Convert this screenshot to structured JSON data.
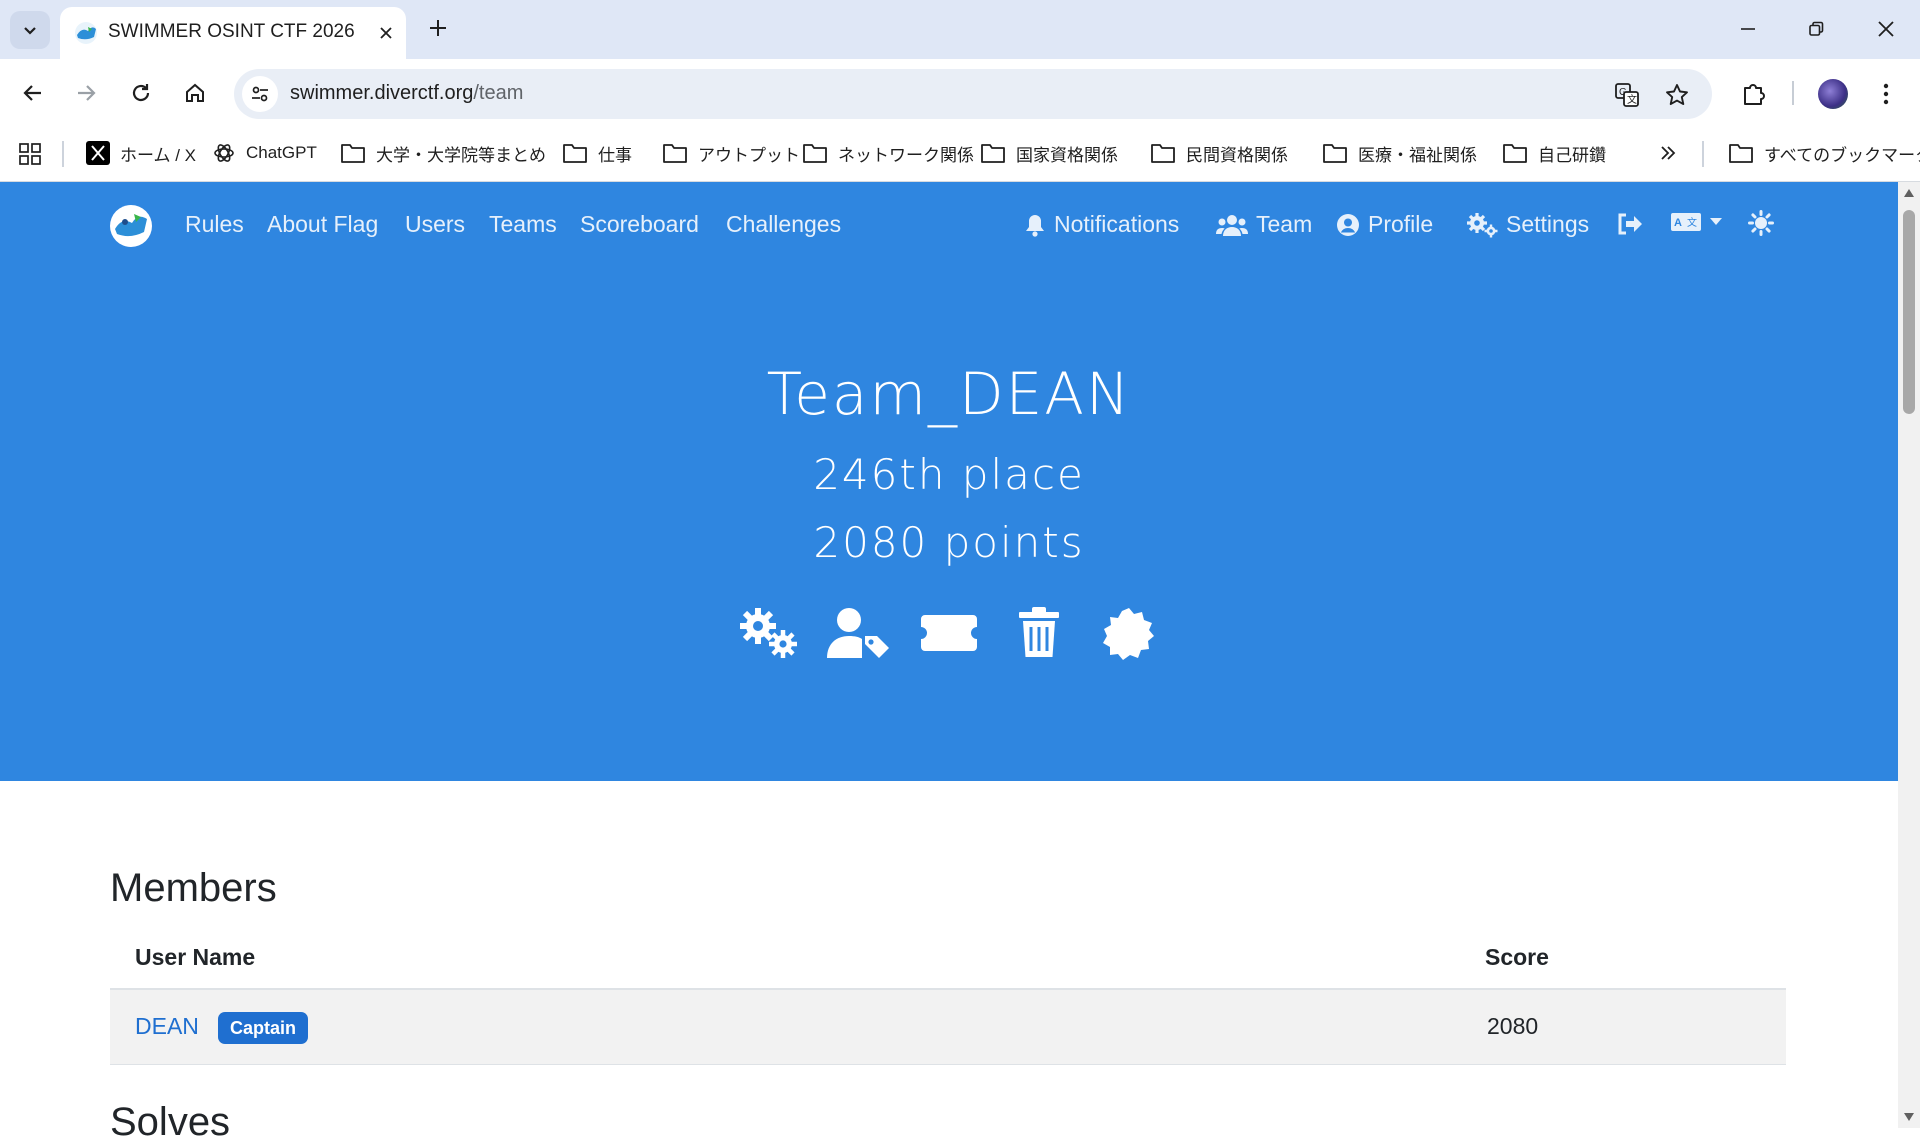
{
  "browser": {
    "tab_title": "SWIMMER OSINT CTF 2026",
    "url_domain": "swimmer.diverctf.org",
    "url_path": "/team",
    "bookmarks": [
      "ホーム / X",
      "ChatGPT",
      "大学・大学院等まとめ",
      "仕事",
      "アウトプット",
      "ネットワーク関係",
      "国家資格関係",
      "民間資格関係",
      "医療・福祉関係",
      "自己研鑽"
    ],
    "all_bookmarks": "すべてのブックマーク"
  },
  "nav": {
    "left": [
      "Rules",
      "About Flag",
      "Users",
      "Teams",
      "Scoreboard",
      "Challenges"
    ],
    "right": [
      "Notifications",
      "Team",
      "Profile",
      "Settings"
    ]
  },
  "team": {
    "name": "Team_DEAN",
    "place": "246th place",
    "points": "2080 points",
    "actions": [
      "settings-icon",
      "user-tag-icon",
      "ticket-icon",
      "trash-icon",
      "badge-icon"
    ]
  },
  "members": {
    "title": "Members",
    "headers": {
      "user": "User Name",
      "score": "Score"
    },
    "rows": [
      {
        "name": "DEAN",
        "badge": "Captain",
        "score": "2080"
      }
    ]
  },
  "solves": {
    "title": "Solves"
  },
  "colors": {
    "hero": "#2f86e0",
    "link": "#1f6fd0"
  }
}
